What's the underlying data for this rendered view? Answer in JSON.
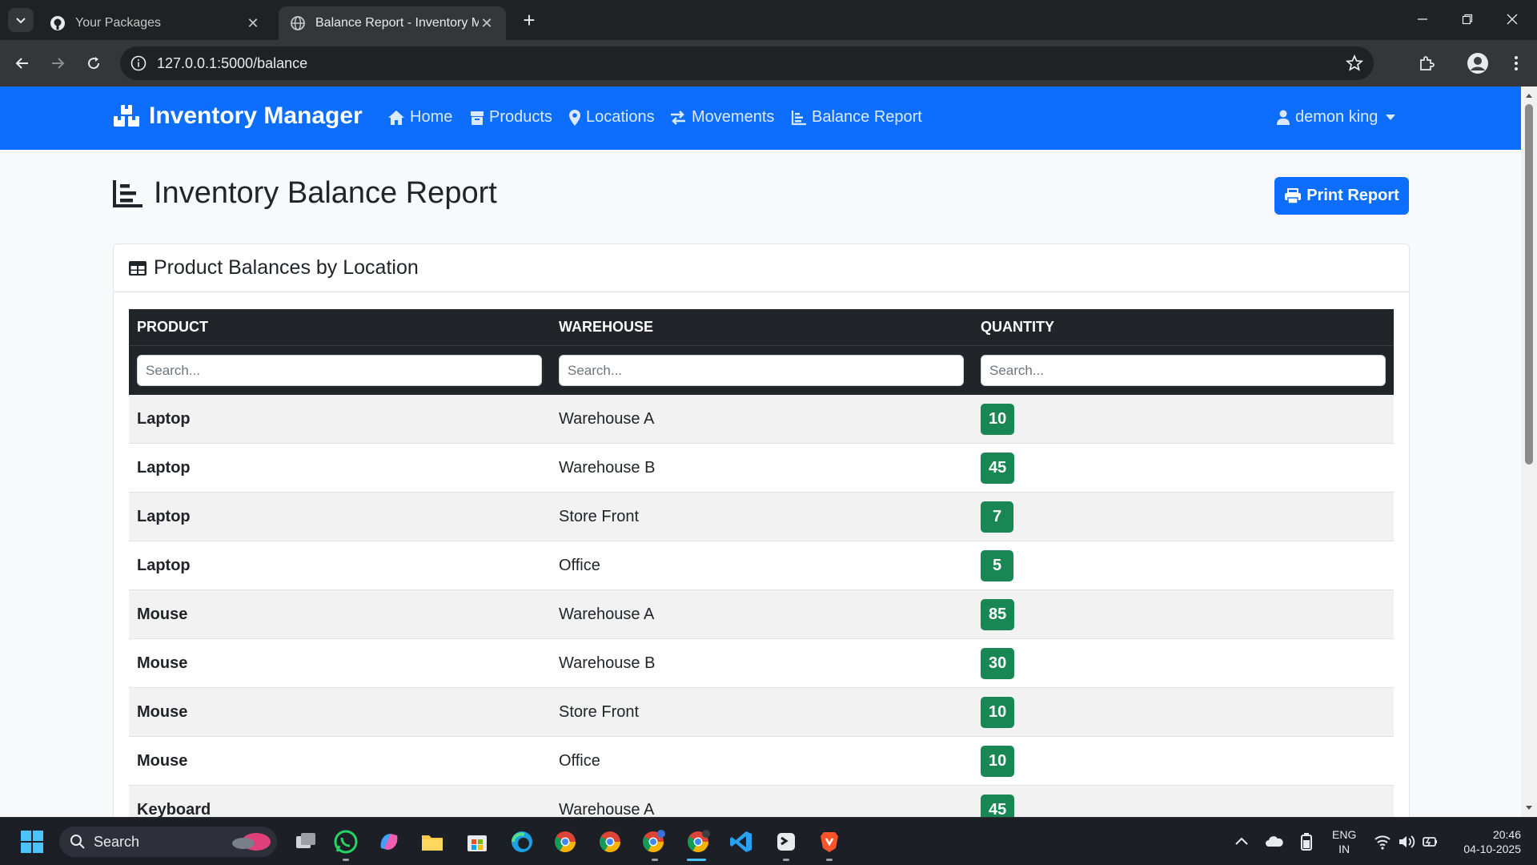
{
  "browser": {
    "tabs": [
      {
        "title": "Your Packages",
        "icon": "github-icon",
        "active": false
      },
      {
        "title": "Balance Report - Inventory Manager",
        "icon": "globe-icon",
        "active": true
      }
    ],
    "url": "127.0.0.1:5000/balance"
  },
  "navbar": {
    "brand": "Inventory Manager",
    "links": [
      "Home",
      "Products",
      "Locations",
      "Movements",
      "Balance Report"
    ],
    "user": "demon king",
    "color": "#0d6efd"
  },
  "page": {
    "title": "Inventory Balance Report",
    "print_label": "Print Report"
  },
  "card": {
    "title": "Product Balances by Location"
  },
  "table": {
    "columns": [
      "PRODUCT",
      "WAREHOUSE",
      "QUANTITY"
    ],
    "search_placeholder": "Search...",
    "rows": [
      {
        "product": "Laptop",
        "location": "Warehouse A",
        "quantity": "10"
      },
      {
        "product": "Laptop",
        "location": "Warehouse B",
        "quantity": "45"
      },
      {
        "product": "Laptop",
        "location": "Store Front",
        "quantity": "7"
      },
      {
        "product": "Laptop",
        "location": "Office",
        "quantity": "5"
      },
      {
        "product": "Mouse",
        "location": "Warehouse A",
        "quantity": "85"
      },
      {
        "product": "Mouse",
        "location": "Warehouse B",
        "quantity": "30"
      },
      {
        "product": "Mouse",
        "location": "Store Front",
        "quantity": "10"
      },
      {
        "product": "Mouse",
        "location": "Office",
        "quantity": "10"
      },
      {
        "product": "Keyboard",
        "location": "Warehouse A",
        "quantity": "45"
      }
    ],
    "badge_color": "#198754"
  },
  "taskbar": {
    "search_label": "Search",
    "lang": [
      "ENG",
      "IN"
    ],
    "time": "20:46",
    "date": "04-10-2025"
  }
}
